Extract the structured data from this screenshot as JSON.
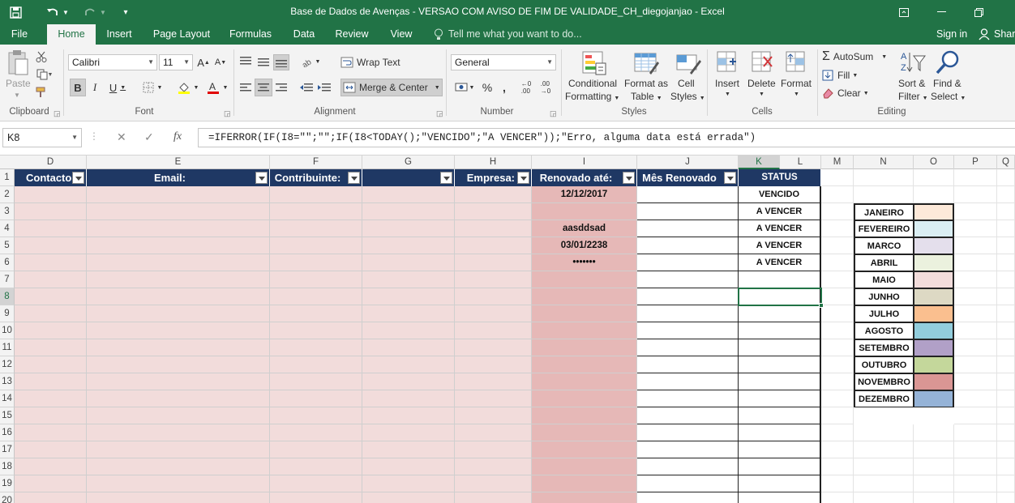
{
  "titlebar": {
    "title": "Base de Dados de Avenças - VERSAO COM AVISO DE FIM DE VALIDADE_CH_diegojanjao - Excel",
    "quick_access": [
      "save-icon",
      "undo-icon",
      "redo-icon",
      "customize-icon"
    ]
  },
  "tabs": [
    "File",
    "Home",
    "Insert",
    "Page Layout",
    "Formulas",
    "Data",
    "Review",
    "View"
  ],
  "active_tab": "Home",
  "tell_me": "Tell me what you want to do...",
  "sign_in": "Sign in",
  "share": "Share",
  "ribbon": {
    "clipboard": {
      "paste": "Paste",
      "label": "Clipboard"
    },
    "font": {
      "name": "Calibri",
      "size": "11",
      "label": "Font"
    },
    "alignment": {
      "wrap": "Wrap Text",
      "merge": "Merge & Center",
      "label": "Alignment"
    },
    "number": {
      "format": "General",
      "label": "Number"
    },
    "styles": {
      "cond1": "Conditional",
      "cond2": "Formatting",
      "fmt1": "Format as",
      "fmt2": "Table",
      "cell1": "Cell",
      "cell2": "Styles",
      "label": "Styles"
    },
    "cells": {
      "insert": "Insert",
      "delete": "Delete",
      "format": "Format",
      "label": "Cells"
    },
    "editing": {
      "autosum": "AutoSum",
      "fill": "Fill",
      "clear": "Clear",
      "sort1": "Sort &",
      "sort2": "Filter",
      "find1": "Find &",
      "find2": "Select",
      "label": "Editing"
    }
  },
  "formula_bar": {
    "name_box": "K8",
    "formula": "=IFERROR(IF(I8=\"\";\"\";IF(I8<TODAY();\"VENCIDO\";\"A VENCER\"));\"Erro, alguma data está errada\")"
  },
  "columns": [
    "D",
    "E",
    "F",
    "G",
    "H",
    "I",
    "J",
    "K",
    "L",
    "M",
    "N",
    "O",
    "P",
    "Q"
  ],
  "rows": [
    "1",
    "2",
    "3",
    "4",
    "5",
    "6",
    "7",
    "8",
    "9",
    "10",
    "11",
    "12",
    "13",
    "14",
    "15",
    "16",
    "17",
    "18",
    "19",
    "20"
  ],
  "active_column": "K",
  "active_row": "8",
  "table_headers": {
    "contacto": "Contacto",
    "email": "Email:",
    "contribuinte": "Contribuinte:",
    "g": "",
    "empresa": "Empresa:",
    "renovado": "Renovado até:",
    "mes": "Mês Renovado",
    "status": "STATUS"
  },
  "renovado_values": [
    "12/12/2017",
    "",
    "aasddsad",
    "03/01/2238",
    "•••••••"
  ],
  "status_values": [
    "VENCIDO",
    "A VENCER",
    "A VENCER",
    "A VENCER",
    "A VENCER"
  ],
  "months": [
    {
      "name": "JANEIRO",
      "color": "#fde9d9"
    },
    {
      "name": "FEVEREIRO",
      "color": "#daeef3"
    },
    {
      "name": "MARCO",
      "color": "#e4dfec"
    },
    {
      "name": "ABRIL",
      "color": "#ebf1de"
    },
    {
      "name": "MAIO",
      "color": "#f2dcdb"
    },
    {
      "name": "JUNHO",
      "color": "#ddd9c4"
    },
    {
      "name": "JULHO",
      "color": "#fabf8f"
    },
    {
      "name": "AGOSTO",
      "color": "#92cddc"
    },
    {
      "name": "SETEMBRO",
      "color": "#b1a0c7"
    },
    {
      "name": "OUTUBRO",
      "color": "#c4d79b"
    },
    {
      "name": "NOVEMBRO",
      "color": "#da9694"
    },
    {
      "name": "DEZEMBRO",
      "color": "#95b3d7"
    }
  ],
  "colors": {
    "excel_green": "#217346",
    "header_navy": "#1f3864",
    "pink_fill": "#f2dcdb",
    "renovado_fill": "#e6b8b7"
  }
}
